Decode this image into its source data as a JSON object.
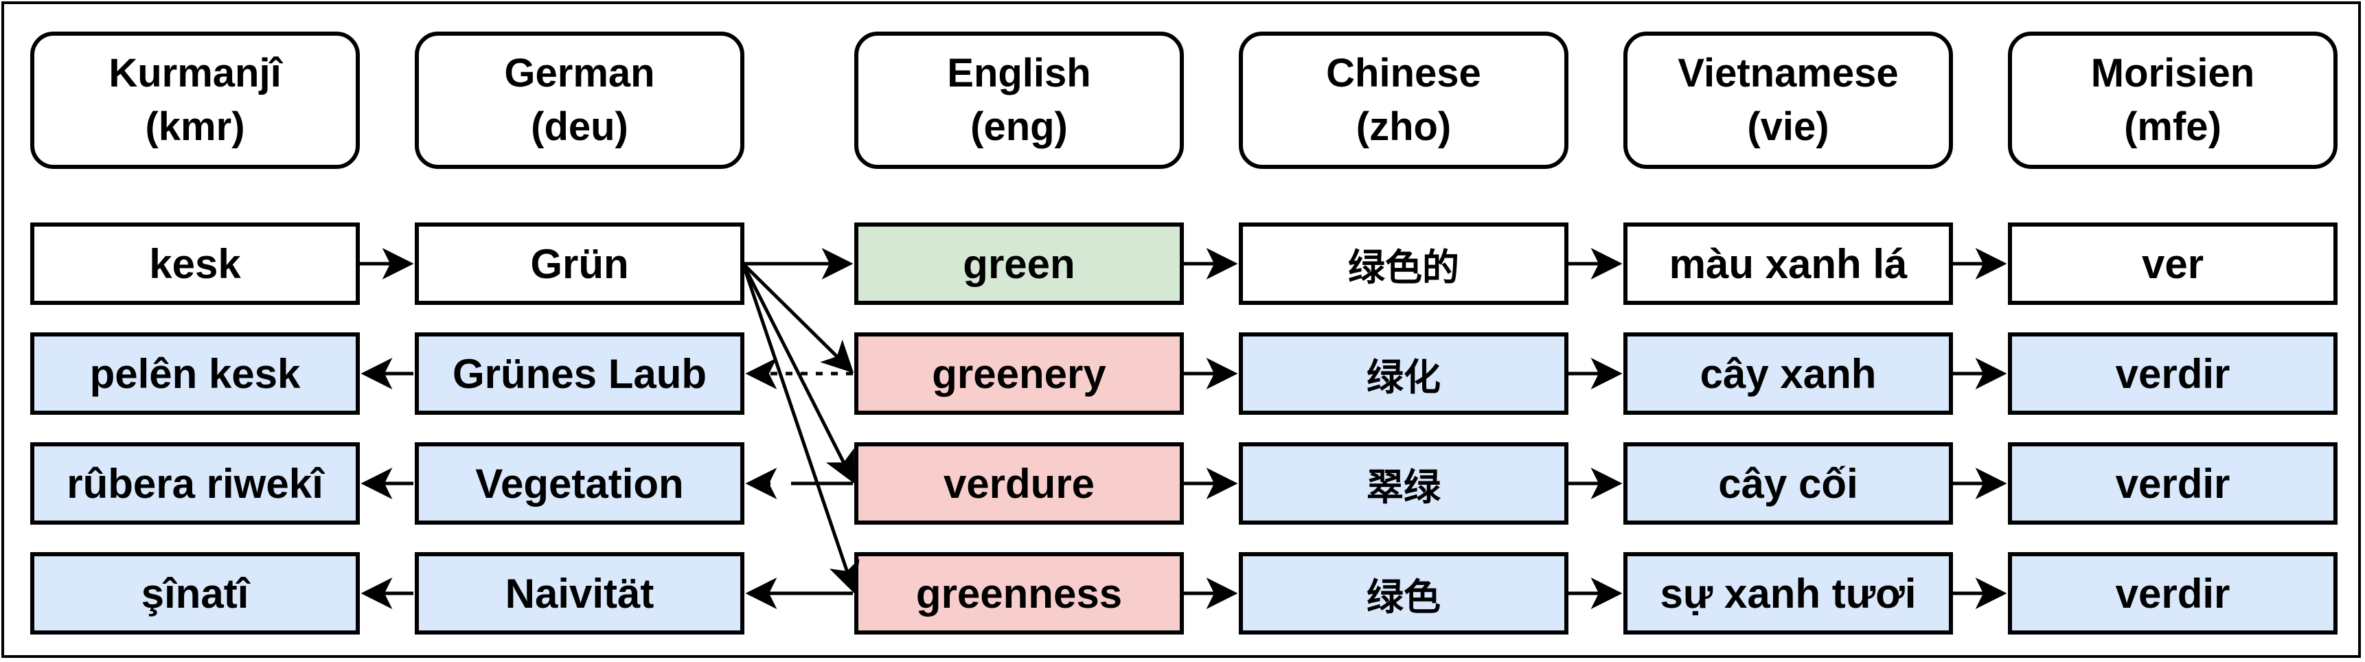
{
  "languages": [
    {
      "name": "Kurmanjî",
      "code": "(kmr)"
    },
    {
      "name": "German",
      "code": "(deu)"
    },
    {
      "name": "English",
      "code": "(eng)"
    },
    {
      "name": "Chinese",
      "code": "(zho)"
    },
    {
      "name": "Vietnamese",
      "code": "(vie)"
    },
    {
      "name": "Morisien",
      "code": "(mfe)"
    }
  ],
  "rows": [
    [
      "kesk",
      "Grün",
      "green",
      "绿色的",
      "màu xanh lá",
      "ver"
    ],
    [
      "pelên kesk",
      "Grünes Laub",
      "greenery",
      "绿化",
      "cây xanh",
      "verdir"
    ],
    [
      "rûbera riwekî",
      "Vegetation",
      "verdure",
      "翠绿",
      "cây cối",
      "verdir"
    ],
    [
      "şînatî",
      "Naivität",
      "greenness",
      "绿色",
      "sự xanh tươi",
      "verdir"
    ]
  ],
  "colors": {
    "source": "#ffffff",
    "translated": "#dae8fc",
    "english_original": "#d5e8d4",
    "english_backtranslated": "#f8cecc",
    "border": "#000000"
  }
}
